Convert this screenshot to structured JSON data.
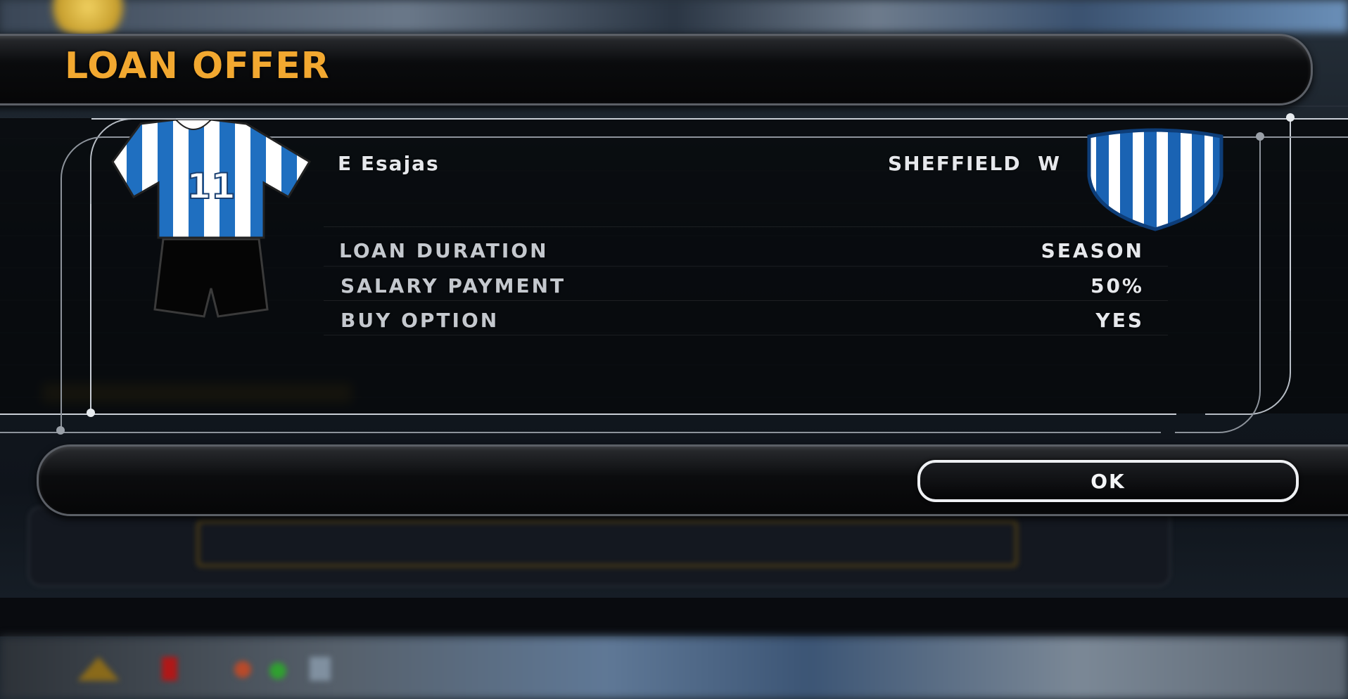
{
  "dialog": {
    "title": "LOAN OFFER",
    "player_name": "E Esajas",
    "club_name": "SHEFFIELD  W",
    "kit_number": "11",
    "terms": [
      {
        "label": "LOAN DURATION",
        "value": "SEASON"
      },
      {
        "label": "SALARY PAYMENT",
        "value": "50%"
      },
      {
        "label": "BUY OPTION",
        "value": "YES"
      }
    ],
    "ok_label": "OK"
  },
  "colors": {
    "title": "#f2a830",
    "kit_blue": "#1f6fc0",
    "kit_white": "#ffffff",
    "crest_blue": "#1a63b3"
  }
}
